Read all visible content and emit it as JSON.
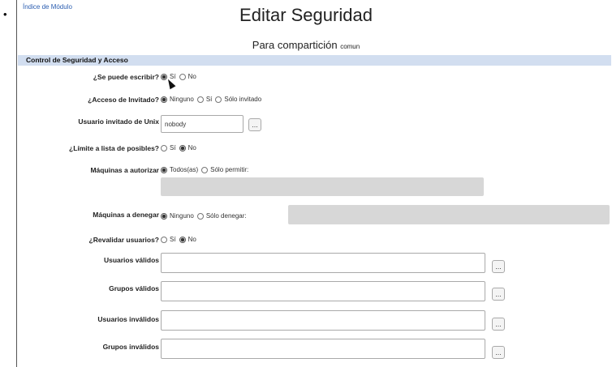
{
  "header": {
    "module_index_link": "Índice de Módulo",
    "title": "Editar Seguridad",
    "subtitle_prefix": "Para compartición",
    "share_name": "comun"
  },
  "section": {
    "title": "Control de Seguridad y Acceso"
  },
  "form": {
    "writable": {
      "label": "¿Se puede escribir?",
      "options": [
        "Sí",
        "No"
      ],
      "selected": "Sí"
    },
    "guest_access": {
      "label": "¿Acceso de Invitado?",
      "options": [
        "Ninguno",
        "Sí",
        "Sólo invitado"
      ],
      "selected": "Ninguno"
    },
    "unix_guest_user": {
      "label": "Usuario invitado de Unix",
      "value": "nobody",
      "picker_label": "..."
    },
    "limit_possible": {
      "label": "¿Límite a lista de posibles?",
      "options": [
        "Sí",
        "No"
      ],
      "selected": "No"
    },
    "allow_hosts": {
      "label": "Máquinas a autorizar",
      "options": [
        "Todos(as)",
        "Sólo permitir:"
      ],
      "selected": "Todos(as)",
      "value": ""
    },
    "deny_hosts": {
      "label": "Máquinas a denegar",
      "options": [
        "Ninguno",
        "Sólo denegar:"
      ],
      "selected": "Ninguno",
      "value": ""
    },
    "revalidate_users": {
      "label": "¿Revalidar usuarios?",
      "options": [
        "Sí",
        "No"
      ],
      "selected": "No"
    },
    "valid_users": {
      "label": "Usuarios válidos",
      "value": "",
      "picker_label": "..."
    },
    "valid_groups": {
      "label": "Grupos válidos",
      "value": "",
      "picker_label": "..."
    },
    "invalid_users": {
      "label": "Usuarios inválidos",
      "value": "",
      "picker_label": "..."
    },
    "invalid_groups": {
      "label": "Grupos inválidos",
      "value": "",
      "picker_label": "..."
    }
  },
  "colors": {
    "section_bar": "#d2def0",
    "link": "#2a5db0",
    "disabled_field": "#d7d7d7"
  }
}
